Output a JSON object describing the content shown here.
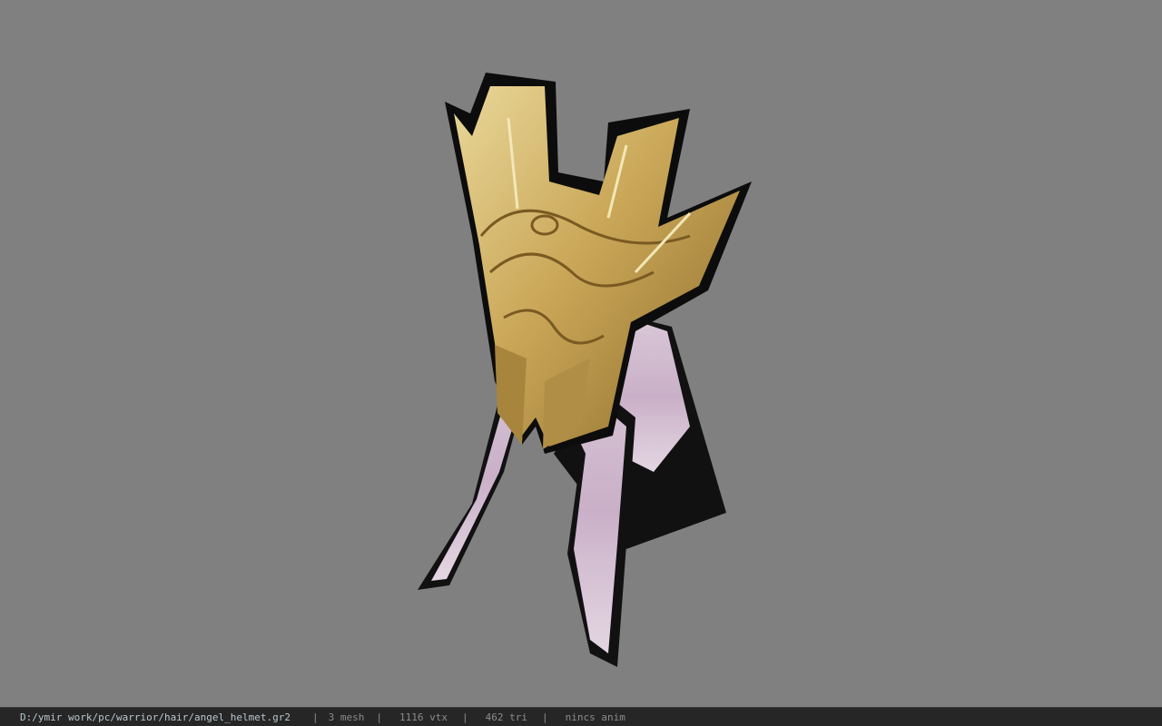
{
  "viewer": {
    "background_color": "#808080",
    "model_name": "angel_helmet"
  },
  "status": {
    "path": "D:/ymir work/pc/warrior/hair/angel_helmet.gr2",
    "separator": "|",
    "mesh": "3 mesh",
    "vtx": "1116 vtx",
    "tri": "462 tri",
    "anim": "nincs anim"
  }
}
